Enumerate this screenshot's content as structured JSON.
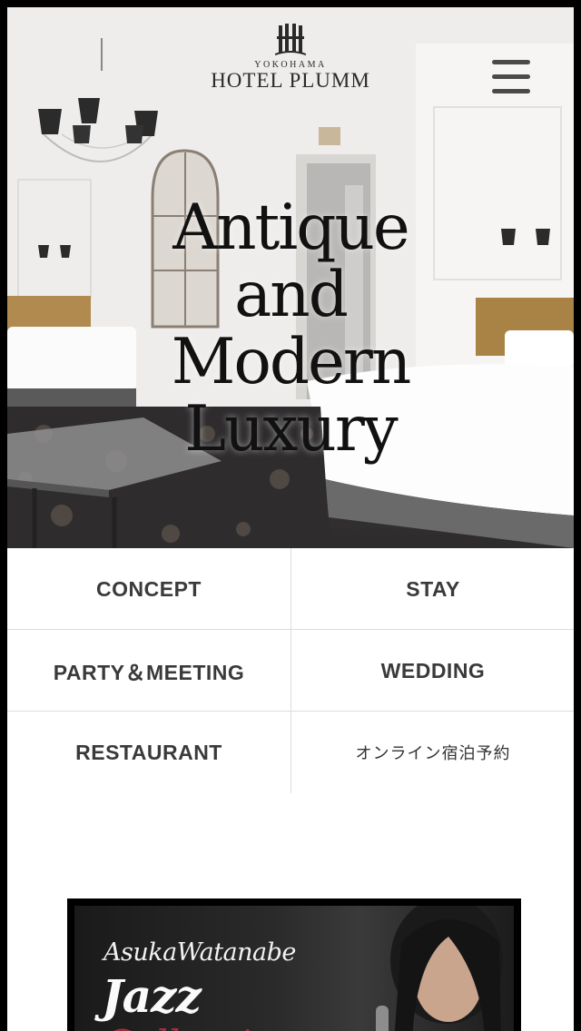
{
  "header": {
    "logo_city": "YOKOHAMA",
    "logo_name": "HOTEL PLUMM",
    "menu_icon": "hamburger-menu-icon"
  },
  "hero": {
    "headline_lines": [
      "Antique",
      "and",
      "Modern",
      "Luxury"
    ]
  },
  "nav": {
    "items": [
      {
        "label": "CONCEPT"
      },
      {
        "label": "STAY"
      },
      {
        "label": "PARTY＆MEETING"
      },
      {
        "label": "WEDDING"
      },
      {
        "label": "RESTAURANT"
      },
      {
        "label": "オンライン宿泊予約"
      }
    ]
  },
  "banner": {
    "artist": "AsukaWatanabe",
    "title": "Jazz",
    "subtitle": "Collection"
  },
  "colors": {
    "nav_text": "#3a3a3a",
    "divider": "#dcdcdc",
    "accent_red": "#a0303a"
  }
}
